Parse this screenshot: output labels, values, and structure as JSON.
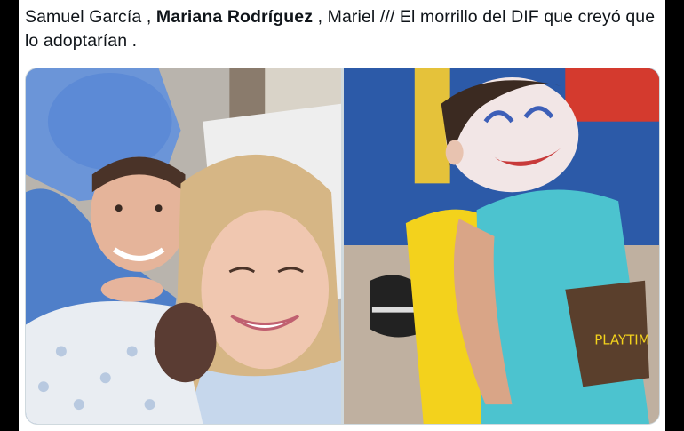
{
  "tweet": {
    "name1": "Samuel García",
    "sep1": " , ",
    "name2": "Mariana Rodríguez",
    "sep2": " , ",
    "name3": "Mariel",
    "rest": " /// El morrillo del DIF que creyó que lo adoptarían ."
  },
  "media": {
    "photos": [
      {
        "description_icon": "family-photo-icon"
      },
      {
        "description_icon": "child-photo-icon"
      }
    ],
    "shirt_text": "PLAYTIM"
  }
}
